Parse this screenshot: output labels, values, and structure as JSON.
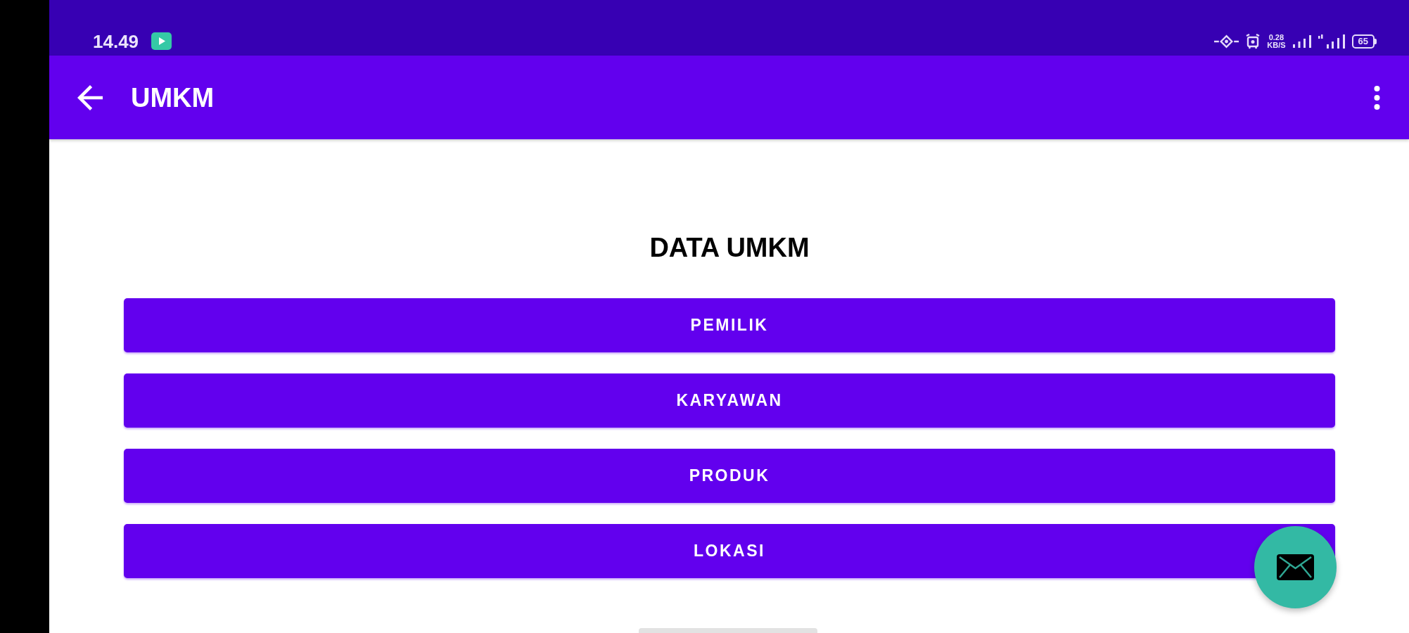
{
  "status_bar": {
    "time": "14.49",
    "network_speed": {
      "value": "0.28",
      "unit": "KB/S"
    },
    "battery": "65"
  },
  "app_bar": {
    "title": "UMKM"
  },
  "heading": "DATA UMKM",
  "menu_buttons": [
    {
      "label": "PEMILIK"
    },
    {
      "label": "KARYAWAN"
    },
    {
      "label": "PRODUK"
    },
    {
      "label": "LOKASI"
    }
  ]
}
